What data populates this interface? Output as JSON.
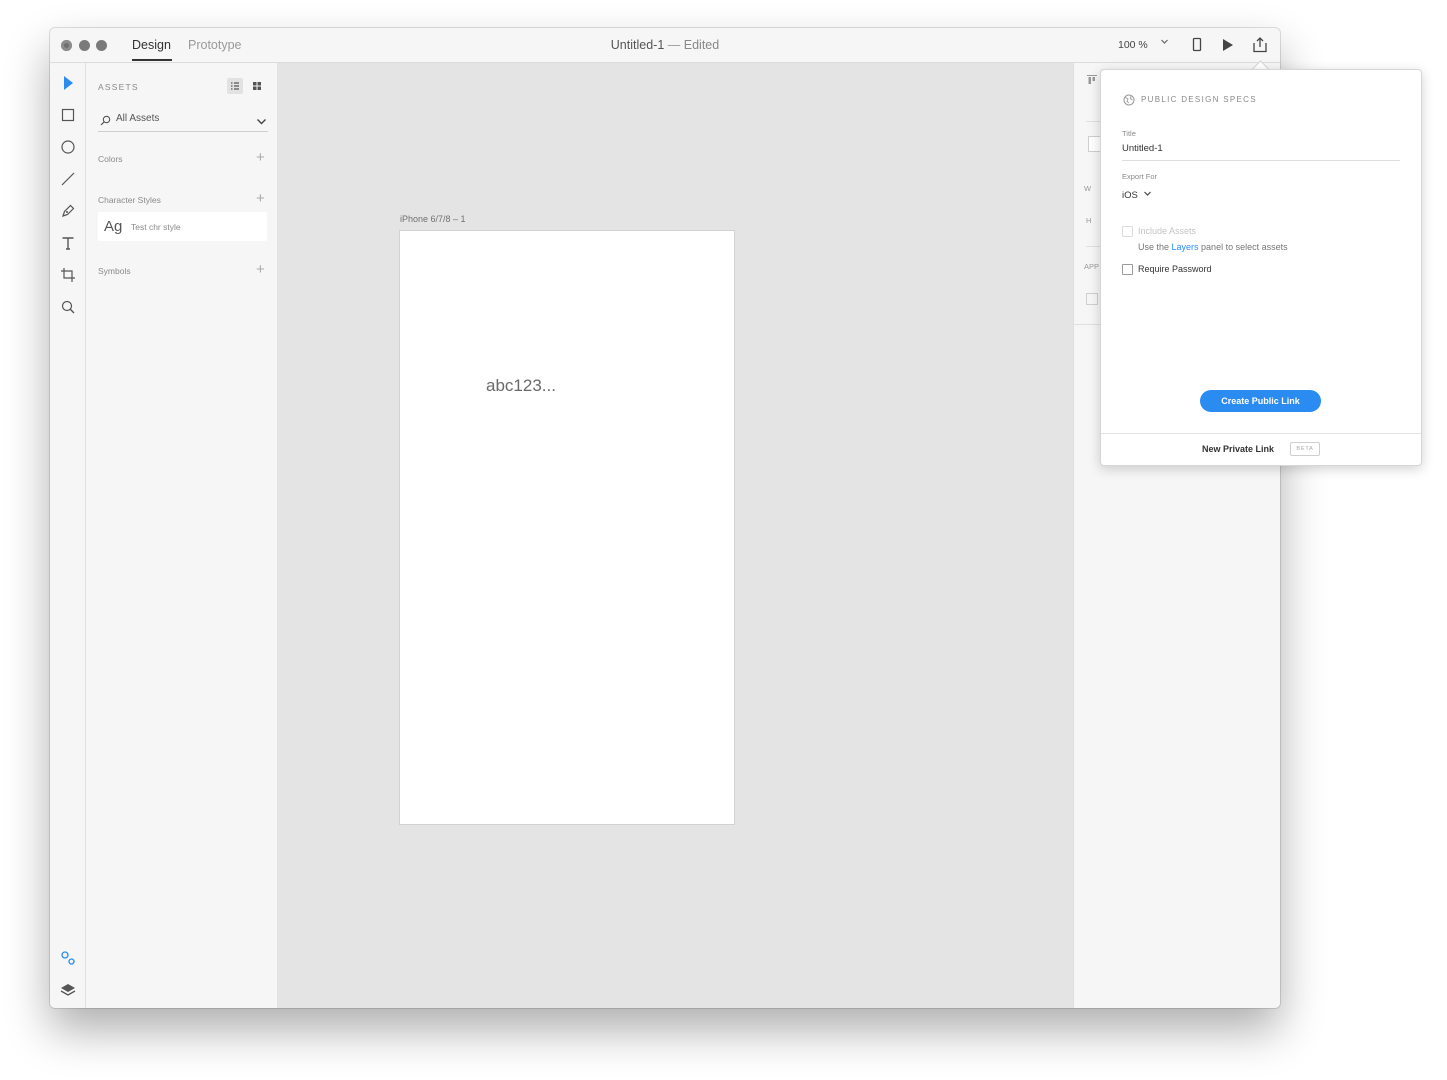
{
  "titlebar": {
    "tabs": [
      {
        "label": "Design",
        "active": true
      },
      {
        "label": "Prototype",
        "active": false
      }
    ],
    "document_name": "Untitled-1",
    "separator": "—",
    "status": "Edited",
    "zoom": "100 %",
    "icons": [
      "device-preview-icon",
      "play-icon",
      "share-icon"
    ]
  },
  "toolbar": {
    "tools": [
      "select-tool-icon",
      "rectangle-tool-icon",
      "ellipse-tool-icon",
      "line-tool-icon",
      "pen-tool-icon",
      "text-tool-icon",
      "artboard-tool-icon",
      "zoom-tool-icon"
    ],
    "bottom": [
      "assets-icon",
      "layers-icon"
    ],
    "accent_color": "#2b8cf0"
  },
  "assets_panel": {
    "title": "ASSETS",
    "filter": "All Assets",
    "sections": {
      "colors": "Colors",
      "character_styles": "Character Styles",
      "symbols": "Symbols"
    },
    "character_style_item": {
      "sample": "Ag",
      "name": "Test chr style"
    }
  },
  "canvas": {
    "artboard_name": "iPhone 6/7/8 – 1",
    "text": "abc123..."
  },
  "props_panel": {
    "letters": [
      "W",
      "H",
      "APP"
    ]
  },
  "share_popover": {
    "header": "PUBLIC DESIGN SPECS",
    "title_label": "Title",
    "title_value": "Untitled-1",
    "export_label": "Export For",
    "export_value": "iOS",
    "include_assets": "Include Assets",
    "help_prefix": "Use the ",
    "help_link": "Layers",
    "help_suffix": " panel to select assets",
    "require_password": "Require Password",
    "create_button": "Create Public Link",
    "private_link": "New Private Link",
    "beta": "BETA",
    "button_color": "#2a8bf0"
  }
}
